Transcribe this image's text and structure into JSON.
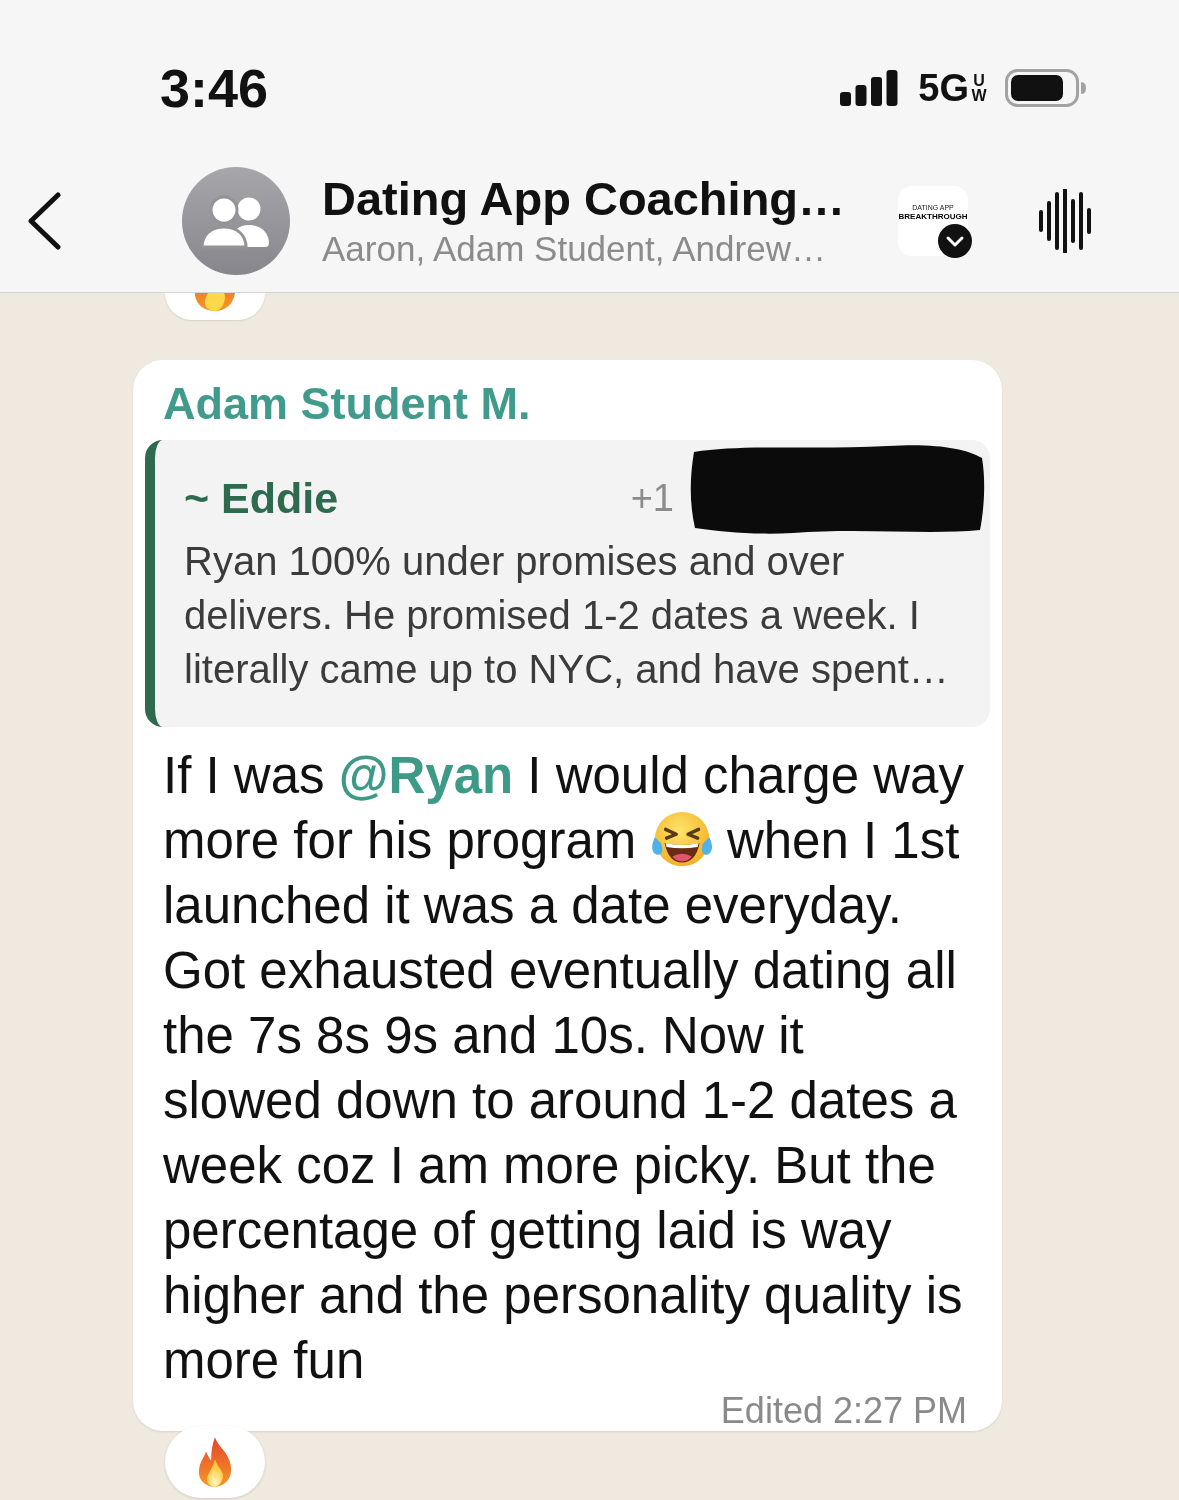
{
  "status_bar": {
    "time": "3:46",
    "network": "5G",
    "network_badge": "UW"
  },
  "header": {
    "title": "Dating App Coaching…",
    "subtitle": "Aaron, Adam Student, Andrew…",
    "logo": {
      "small_text": "DATING APP",
      "main_text": "BREAKTHROUGH"
    }
  },
  "messages": [
    {
      "kind": "cut_off",
      "reaction": true
    },
    {
      "kind": "text",
      "sender": "Adam Student M.",
      "quote": {
        "author": "~ Eddie",
        "phone": "+1",
        "phone_redacted": true,
        "text": "Ryan 100% under promises and over delivers. He promised 1-2 dates a week. I literally came up to NYC, and have spent…"
      },
      "body": [
        {
          "kind": "text",
          "text": "If I was "
        },
        {
          "kind": "mention",
          "text": "@Ryan"
        },
        {
          "kind": "text",
          "text": " I would charge way more for his program "
        },
        {
          "kind": "emoji"
        },
        {
          "kind": "text",
          "text": " when I 1st launched it was a date everyday. Got exhausted eventually dating all the 7s 8s 9s and 10s. Now it slowed down to around 1-2 dates a week coz I am more picky. But the percentage of getting laid is way higher and the personality quality is more fun"
        }
      ],
      "edited_label": "Edited",
      "time": "2:27 PM",
      "reaction": true
    }
  ]
}
